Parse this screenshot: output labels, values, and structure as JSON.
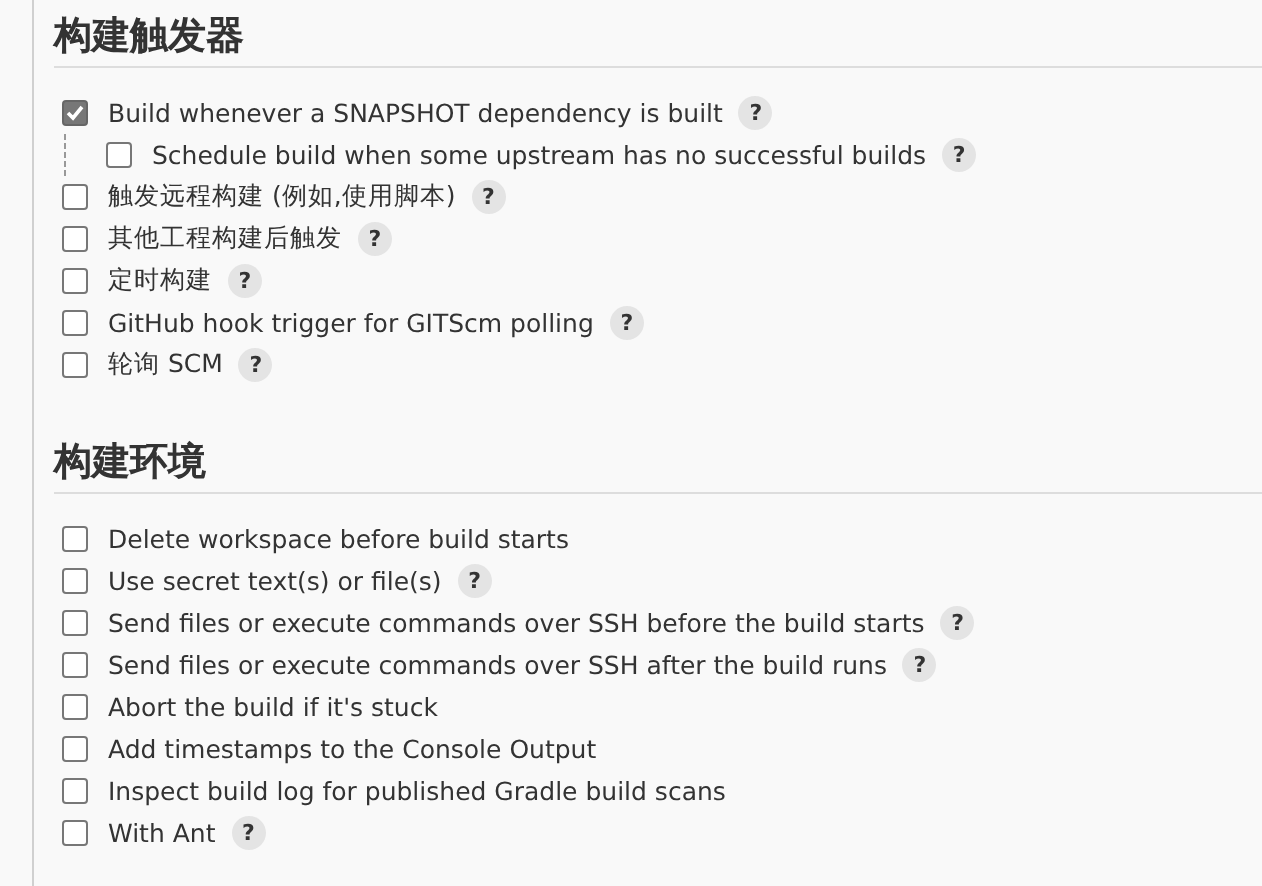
{
  "sections": [
    {
      "title": "构建触发器",
      "items": [
        {
          "label": "Build whenever a SNAPSHOT dependency is built",
          "checked": true,
          "help": "?",
          "children": [
            {
              "label": "Schedule build when some upstream has no successful builds",
              "checked": false,
              "help": "?"
            }
          ]
        },
        {
          "label": "触发远程构建 (例如,使用脚本)",
          "checked": false,
          "help": "?"
        },
        {
          "label": "其他工程构建后触发",
          "checked": false,
          "help": "?"
        },
        {
          "label": "定时构建",
          "checked": false,
          "help": "?"
        },
        {
          "label": "GitHub hook trigger for GITScm polling",
          "checked": false,
          "help": "?"
        },
        {
          "label": "轮询 SCM",
          "checked": false,
          "help": "?"
        }
      ]
    },
    {
      "title": "构建环境",
      "items": [
        {
          "label": "Delete workspace before build starts",
          "checked": false
        },
        {
          "label": "Use secret text(s) or file(s)",
          "checked": false,
          "help": "?"
        },
        {
          "label": "Send files or execute commands over SSH before the build starts",
          "checked": false,
          "help": "?"
        },
        {
          "label": "Send files or execute commands over SSH after the build runs",
          "checked": false,
          "help": "?"
        },
        {
          "label": "Abort the build if it's stuck",
          "checked": false
        },
        {
          "label": "Add timestamps to the Console Output",
          "checked": false
        },
        {
          "label": "Inspect build log for published Gradle build scans",
          "checked": false
        },
        {
          "label": "With Ant",
          "checked": false,
          "help": "?"
        }
      ]
    }
  ]
}
